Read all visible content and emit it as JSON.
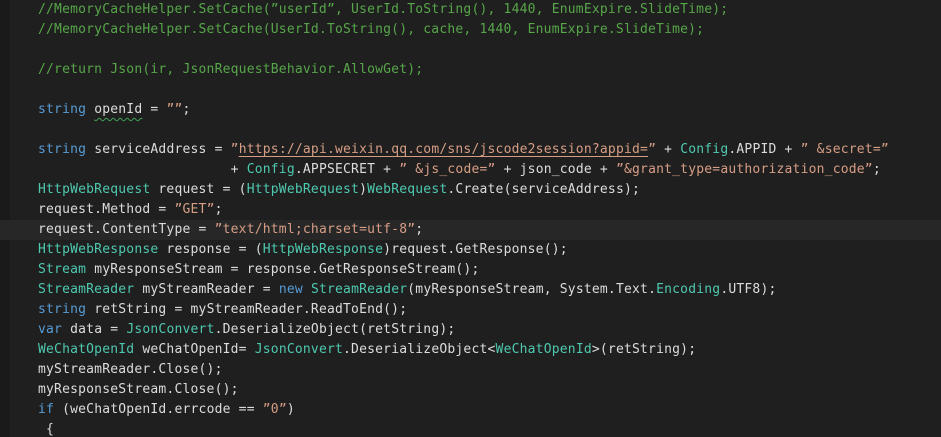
{
  "editor": {
    "background_color": "#1f1f1f",
    "highlight_line_background": "#272727",
    "token_colors": {
      "comment": "#57A64A",
      "keyword": "#569CD6",
      "type": "#4EC9B0",
      "string": "#D69D85",
      "plain": "#DCDCDC",
      "squiggle_underline": "#3fa257"
    },
    "lines": [
      {
        "tokens": [
          [
            "c",
            "//MemoryCacheHelper.SetCache(”userId”, UserId.ToString(), 1440, EnumExpire.SlideTime);"
          ]
        ]
      },
      {
        "tokens": [
          [
            "c",
            "//MemoryCacheHelper.SetCache(UserId.ToString(), cache, 1440, EnumExpire.SlideTime);"
          ]
        ]
      },
      {
        "tokens": []
      },
      {
        "tokens": [
          [
            "c",
            "//return Json(ir, JsonRequestBehavior.AllowGet);"
          ]
        ]
      },
      {
        "tokens": []
      },
      {
        "tokens": [
          [
            "k",
            "string"
          ],
          [
            "p",
            " "
          ],
          [
            "w",
            "openId"
          ],
          [
            "p",
            " = "
          ],
          [
            "s",
            "””"
          ],
          [
            "p",
            ";"
          ]
        ]
      },
      {
        "tokens": []
      },
      {
        "tokens": [
          [
            "k",
            "string"
          ],
          [
            "p",
            " serviceAddress = "
          ],
          [
            "s",
            "”"
          ],
          [
            "u",
            "https://api.weixin.qq.com/sns/jscode2session?appid="
          ],
          [
            "s",
            "”"
          ],
          [
            "p",
            " + "
          ],
          [
            "t",
            "Config"
          ],
          [
            "p",
            ".APPID + "
          ],
          [
            "s",
            "” &secret=”"
          ]
        ]
      },
      {
        "tokens": [
          [
            "p",
            "                        + "
          ],
          [
            "t",
            "Config"
          ],
          [
            "p",
            ".APPSECRET + "
          ],
          [
            "s",
            "” &js_code=”"
          ],
          [
            "p",
            " + json_code + "
          ],
          [
            "s",
            "”&grant_type=authorization_code”"
          ],
          [
            "p",
            ";"
          ]
        ]
      },
      {
        "tokens": [
          [
            "t",
            "HttpWebRequest"
          ],
          [
            "p",
            " request = ("
          ],
          [
            "t",
            "HttpWebRequest"
          ],
          [
            "p",
            ")"
          ],
          [
            "t",
            "WebRequest"
          ],
          [
            "p",
            ".Create(serviceAddress);"
          ]
        ]
      },
      {
        "tokens": [
          [
            "p",
            "request.Method = "
          ],
          [
            "s",
            "”GET”"
          ],
          [
            "p",
            ";"
          ]
        ]
      },
      {
        "hl": true,
        "tokens": [
          [
            "p",
            "request.ContentType = "
          ],
          [
            "s",
            "”text/html;charset=utf-8”"
          ],
          [
            "p",
            ";"
          ]
        ]
      },
      {
        "tokens": [
          [
            "t",
            "HttpWebResponse"
          ],
          [
            "p",
            " response = ("
          ],
          [
            "t",
            "HttpWebResponse"
          ],
          [
            "p",
            ")request.GetResponse();"
          ]
        ]
      },
      {
        "tokens": [
          [
            "t",
            "Stream"
          ],
          [
            "p",
            " myResponseStream = response.GetResponseStream();"
          ]
        ]
      },
      {
        "tokens": [
          [
            "t",
            "StreamReader"
          ],
          [
            "p",
            " myStreamReader = "
          ],
          [
            "k",
            "new"
          ],
          [
            "p",
            " "
          ],
          [
            "t",
            "StreamReader"
          ],
          [
            "p",
            "(myResponseStream, System.Text."
          ],
          [
            "t",
            "Encoding"
          ],
          [
            "p",
            ".UTF8);"
          ]
        ]
      },
      {
        "tokens": [
          [
            "k",
            "string"
          ],
          [
            "p",
            " retString = myStreamReader.ReadToEnd();"
          ]
        ]
      },
      {
        "tokens": [
          [
            "k",
            "var"
          ],
          [
            "p",
            " data = "
          ],
          [
            "t",
            "JsonConvert"
          ],
          [
            "p",
            ".DeserializeObject(retString);"
          ]
        ]
      },
      {
        "tokens": [
          [
            "t",
            "WeChatOpenId"
          ],
          [
            "p",
            " weChatOpenId= "
          ],
          [
            "t",
            "JsonConvert"
          ],
          [
            "p",
            ".DeserializeObject<"
          ],
          [
            "t",
            "WeChatOpenId"
          ],
          [
            "p",
            ">(retString);"
          ]
        ]
      },
      {
        "tokens": [
          [
            "p",
            "myStreamReader.Close();"
          ]
        ]
      },
      {
        "tokens": [
          [
            "p",
            "myResponseStream.Close();"
          ]
        ]
      },
      {
        "tokens": [
          [
            "k",
            "if"
          ],
          [
            "p",
            " (weChatOpenId.errcode == "
          ],
          [
            "s",
            "”0”"
          ],
          [
            "p",
            ")"
          ]
        ]
      },
      {
        "tokens": [
          [
            "p",
            " {"
          ]
        ]
      }
    ]
  }
}
